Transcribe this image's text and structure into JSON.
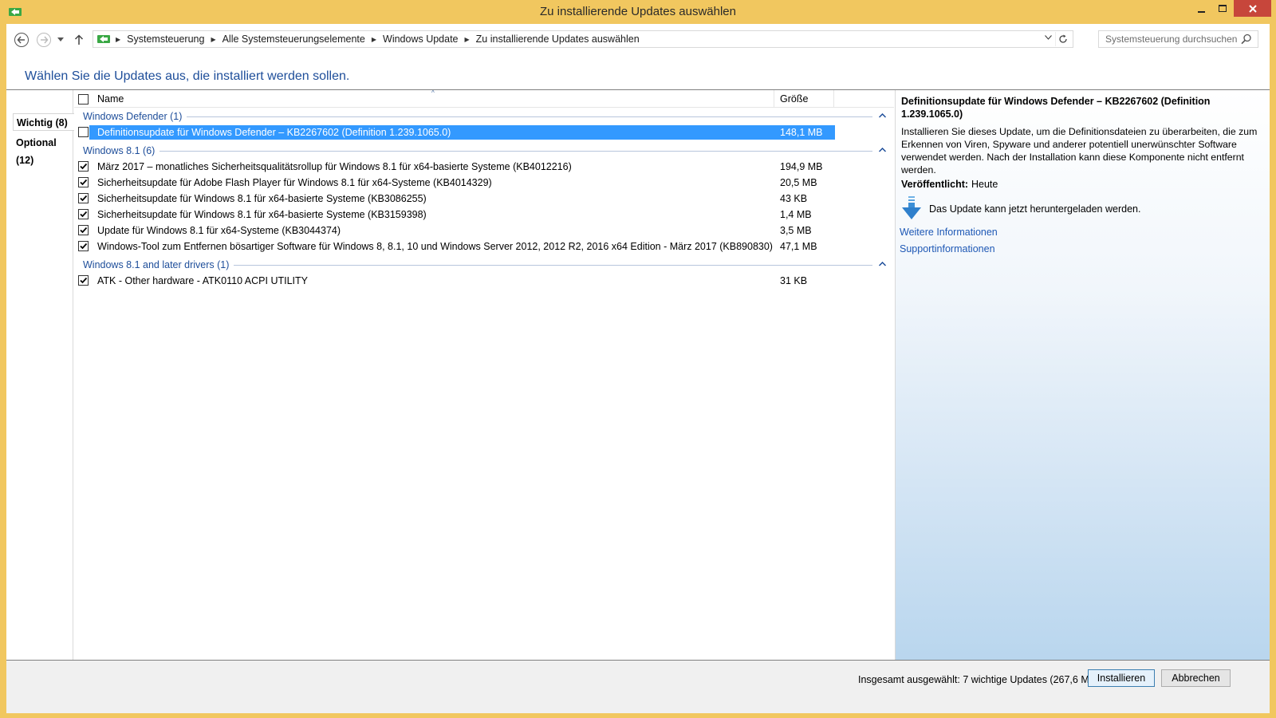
{
  "window": {
    "title": "Zu installierende Updates auswählen",
    "colors": {
      "frame": "#f1c75f",
      "close": "#c7463b",
      "accent": "#1e4e9a",
      "selection": "#3399ff"
    }
  },
  "nav": {
    "breadcrumb": [
      "Systemsteuerung",
      "Alle Systemsteuerungselemente",
      "Windows Update",
      "Zu installierende Updates auswählen"
    ],
    "search_placeholder": "Systemsteuerung durchsuchen"
  },
  "heading": "Wählen Sie die Updates aus, die installiert werden sollen.",
  "categories": [
    {
      "label": "Wichtig (8)",
      "selected": true
    },
    {
      "label": "Optional (12)",
      "selected": false
    }
  ],
  "list": {
    "columns": {
      "name": "Name",
      "size": "Größe"
    },
    "groups": [
      {
        "label": "Windows Defender (1)",
        "items": [
          {
            "name": "Definitionsupdate für Windows Defender – KB2267602 (Definition 1.239.1065.0)",
            "size": "148,1 MB",
            "checked": false,
            "selected": true
          }
        ]
      },
      {
        "label": "Windows 8.1 (6)",
        "items": [
          {
            "name": "März 2017 – monatliches Sicherheitsqualitätsrollup für Windows 8.1 für x64-basierte Systeme (KB4012216)",
            "size": "194,9 MB",
            "checked": true
          },
          {
            "name": "Sicherheitsupdate für Adobe Flash Player für Windows 8.1 für x64-Systeme (KB4014329)",
            "size": "20,5 MB",
            "checked": true
          },
          {
            "name": "Sicherheitsupdate für Windows 8.1 für x64-basierte Systeme (KB3086255)",
            "size": "43 KB",
            "checked": true
          },
          {
            "name": "Sicherheitsupdate für Windows 8.1 für x64-basierte Systeme (KB3159398)",
            "size": "1,4 MB",
            "checked": true
          },
          {
            "name": "Update für Windows 8.1 für x64-Systeme (KB3044374)",
            "size": "3,5 MB",
            "checked": true
          },
          {
            "name": "Windows-Tool zum Entfernen bösartiger Software für Windows 8, 8.1, 10 und Windows Server 2012, 2012 R2, 2016 x64 Edition - März 2017 (KB890830)",
            "size": "47,1 MB",
            "checked": true
          }
        ]
      },
      {
        "label": "Windows 8.1 and later drivers (1)",
        "items": [
          {
            "name": "ATK - Other hardware - ATK0110 ACPI UTILITY",
            "size": "31 KB",
            "checked": true
          }
        ]
      }
    ]
  },
  "details": {
    "title": "Definitionsupdate für Windows Defender – KB2267602 (Definition 1.239.1065.0)",
    "description": "Installieren Sie dieses Update, um die Definitionsdateien zu überarbeiten, die zum Erkennen von Viren, Spyware und anderer potentiell unerwünschter Software verwendet werden. Nach der Installation kann diese Komponente nicht entfernt werden.",
    "published_label": "Veröffentlicht:",
    "published_value": "Heute",
    "download_text": "Das Update kann jetzt heruntergeladen werden.",
    "links": [
      "Weitere Informationen",
      "Supportinformationen"
    ]
  },
  "footer": {
    "total": "Insgesamt ausgewählt: 7 wichtige Updates (267,6 MB)",
    "install_label": "Installieren",
    "cancel_label": "Abbrechen"
  }
}
